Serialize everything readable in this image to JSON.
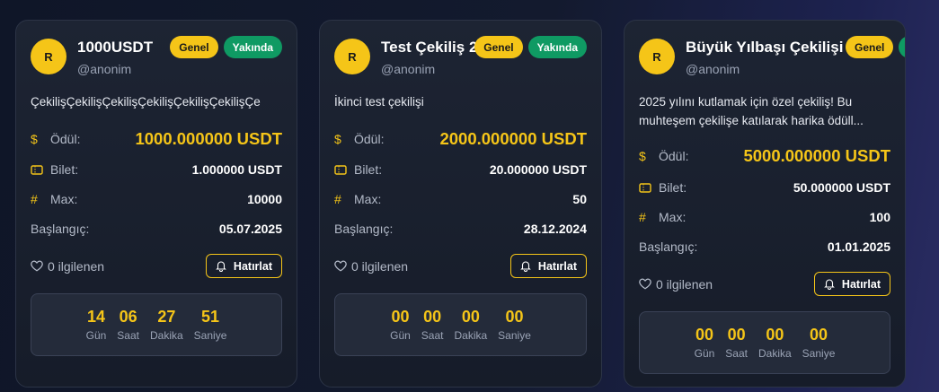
{
  "cards": [
    {
      "avatar": "R",
      "title": "1000USDT",
      "user": "@anonim",
      "badges": [
        "Genel",
        "Yakında"
      ],
      "description": "ÇekilişÇekilişÇekilişÇekilişÇekilişÇekilişÇe",
      "reward_label": "Ödül:",
      "reward_value": "1000.000000 USDT",
      "ticket_label": "Bilet:",
      "ticket_value": "1.000000 USDT",
      "max_label": "Max:",
      "max_value": "10000",
      "start_label": "Başlangıç:",
      "start_value": "05.07.2025",
      "interest": "0 ilgilenen",
      "remind_label": "Hatırlat",
      "countdown": [
        {
          "num": "14",
          "label": "Gün"
        },
        {
          "num": "06",
          "label": "Saat"
        },
        {
          "num": "27",
          "label": "Dakika"
        },
        {
          "num": "51",
          "label": "Saniye"
        }
      ]
    },
    {
      "avatar": "R",
      "title": "Test Çekiliş 2",
      "user": "@anonim",
      "badges": [
        "Genel",
        "Yakında"
      ],
      "description": "İkinci test çekilişi",
      "reward_label": "Ödül:",
      "reward_value": "2000.000000 USDT",
      "ticket_label": "Bilet:",
      "ticket_value": "20.000000 USDT",
      "max_label": "Max:",
      "max_value": "50",
      "start_label": "Başlangıç:",
      "start_value": "28.12.2024",
      "interest": "0 ilgilenen",
      "remind_label": "Hatırlat",
      "countdown": [
        {
          "num": "00",
          "label": "Gün"
        },
        {
          "num": "00",
          "label": "Saat"
        },
        {
          "num": "00",
          "label": "Dakika"
        },
        {
          "num": "00",
          "label": "Saniye"
        }
      ]
    },
    {
      "avatar": "R",
      "title": "Büyük Yılbaşı Çekilişi",
      "user": "@anonim",
      "badges": [
        "Genel",
        ""
      ],
      "description": "2025 yılını kutlamak için özel çekiliş! Bu muhteşem çekilişe katılarak harika ödüll...",
      "reward_label": "Ödül:",
      "reward_value": "5000.000000 USDT",
      "ticket_label": "Bilet:",
      "ticket_value": "50.000000 USDT",
      "max_label": "Max:",
      "max_value": "100",
      "start_label": "Başlangıç:",
      "start_value": "01.01.2025",
      "interest": "0 ilgilenen",
      "remind_label": "Hatırlat",
      "countdown": [
        {
          "num": "00",
          "label": "Gün"
        },
        {
          "num": "00",
          "label": "Saat"
        },
        {
          "num": "00",
          "label": "Dakika"
        },
        {
          "num": "00",
          "label": "Saniye"
        }
      ]
    }
  ],
  "icons": {
    "reward": "dollar-icon",
    "ticket": "ticket-icon",
    "max": "hash-icon",
    "interest": "heart-icon",
    "remind": "bell-icon"
  },
  "colors": {
    "accent": "#f5c518",
    "success": "#0f9a63",
    "card_bg": "#1a2130"
  }
}
